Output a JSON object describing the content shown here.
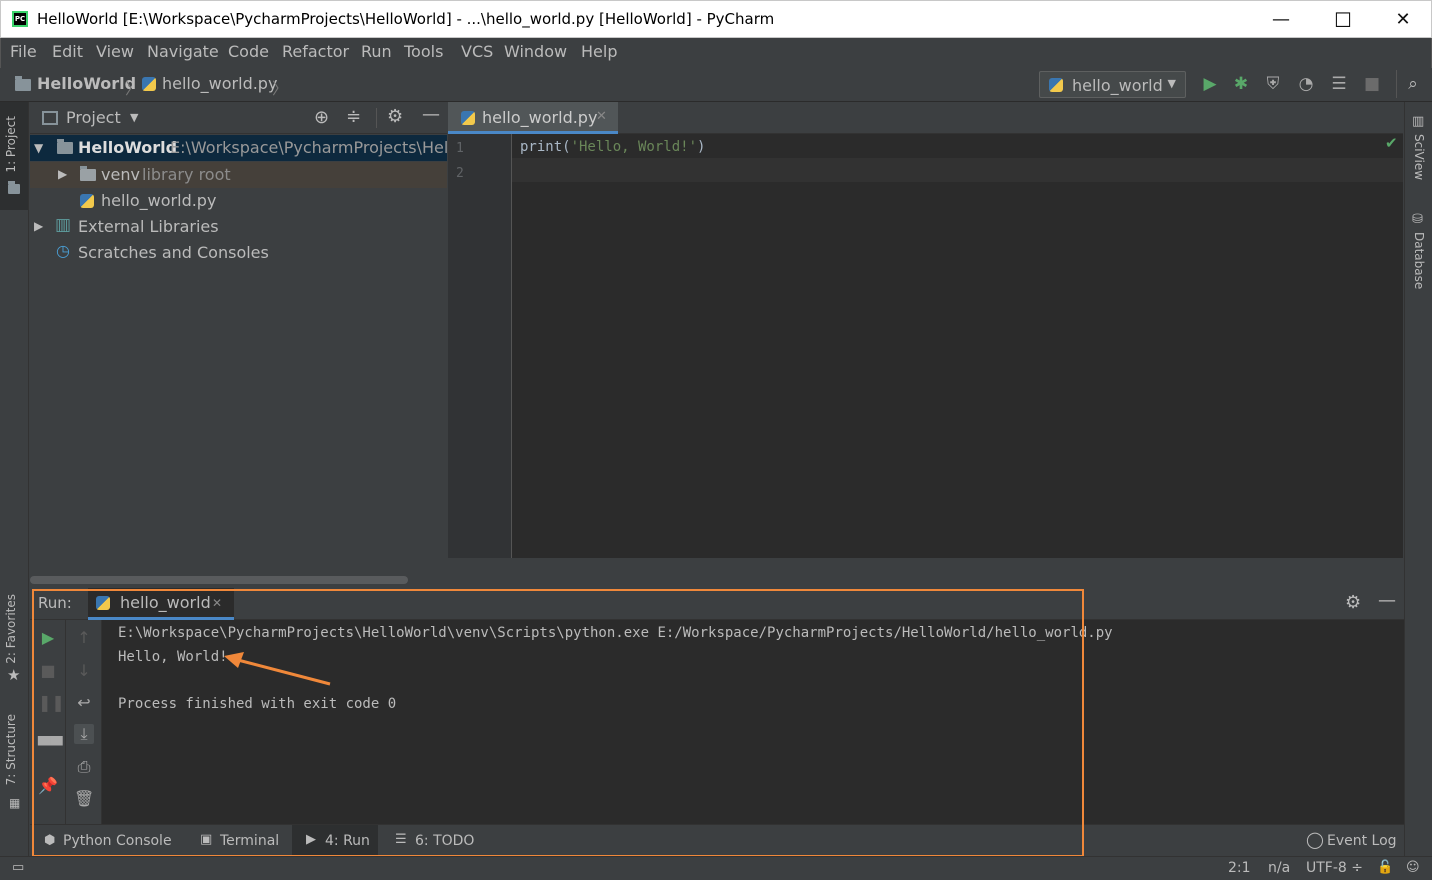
{
  "window": {
    "title": "HelloWorld [E:\\Workspace\\PycharmProjects\\HelloWorld] - ...\\hello_world.py [HelloWorld] - PyCharm",
    "app_icon_text": "PC",
    "minimize": "—",
    "maximize": "☐",
    "close": "✕"
  },
  "menu": [
    "File",
    "Edit",
    "View",
    "Navigate",
    "Code",
    "Refactor",
    "Run",
    "Tools",
    "VCS",
    "Window",
    "Help"
  ],
  "breadcrumb": {
    "project": "HelloWorld",
    "file": "hello_world.py"
  },
  "run_config": {
    "label": "hello_world",
    "caret": "▼"
  },
  "left_strip": {
    "project_tab": "1: Project",
    "favorites_tab": "2: Favorites",
    "structure_tab": "7: Structure"
  },
  "right_strip": {
    "sciview_tab": "SciView",
    "database_tab": "Database"
  },
  "project_panel": {
    "title": "Project",
    "tree": [
      {
        "name": "HelloWorld",
        "detail": "E:\\Workspace\\PycharmProjects\\HelloW"
      },
      {
        "name": "venv",
        "detail": "library root"
      },
      {
        "name": "hello_world.py",
        "detail": ""
      },
      {
        "name": "External Libraries",
        "detail": ""
      },
      {
        "name": "Scratches and Consoles",
        "detail": ""
      }
    ]
  },
  "editor": {
    "tab": "hello_world.py",
    "line_numbers": [
      "1",
      "2"
    ],
    "code": {
      "func": "print(",
      "string": "'Hello, World!'",
      "close": ")"
    }
  },
  "run_panel": {
    "label": "Run:",
    "tab": "hello_world",
    "console": [
      "E:\\Workspace\\PycharmProjects\\HelloWorld\\venv\\Scripts\\python.exe E:/Workspace/PycharmProjects/HelloWorld/hello_world.py",
      "Hello, World!",
      "",
      "Process finished with exit code 0"
    ]
  },
  "bottom_tabs": {
    "python_console": "Python Console",
    "terminal": "Terminal",
    "run": "4: Run",
    "todo": "6: TODO",
    "event_log": "Event Log"
  },
  "status": {
    "position": "2:1",
    "na": "n/a",
    "encoding": "UTF-8 ÷"
  },
  "colors": {
    "background": "#2b2b2b",
    "panel": "#3c3f41",
    "run_green": "#59a869",
    "highlight_orange": "#f0883a",
    "string_green": "#6a8759",
    "selection": "#0d293e"
  }
}
